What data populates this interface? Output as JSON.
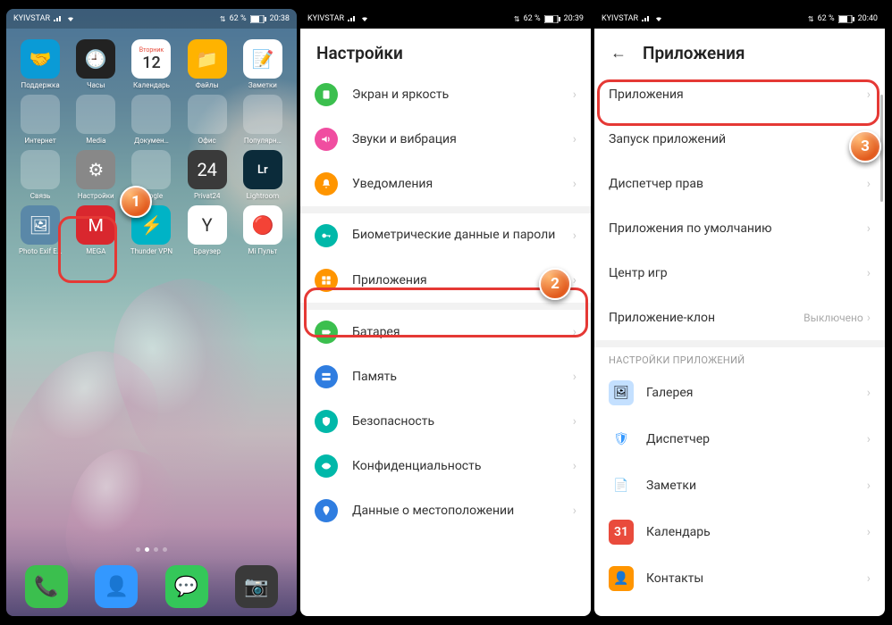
{
  "status": {
    "carrier": "KYIVSTAR",
    "battery": "62 %",
    "times": [
      "20:38",
      "20:39",
      "20:40"
    ]
  },
  "phone1": {
    "apps_row1": [
      {
        "lbl": "Поддержка",
        "bg": "#0a9bd6",
        "glyph": "🤝"
      },
      {
        "lbl": "Часы",
        "bg": "#222",
        "glyph": "🕘"
      },
      {
        "lbl": "Календарь",
        "bg": "#fff",
        "glyph": "cal",
        "day": "Вторник",
        "num": "12"
      },
      {
        "lbl": "Файлы",
        "bg": "#ffb300",
        "glyph": "📁"
      },
      {
        "lbl": "Заметки",
        "bg": "#fff",
        "glyph": "📝"
      }
    ],
    "apps_row2": [
      {
        "lbl": "Интернет",
        "folder": true
      },
      {
        "lbl": "Media",
        "folder": true
      },
      {
        "lbl": "Докумен…",
        "folder": true
      },
      {
        "lbl": "Офис",
        "folder": true
      },
      {
        "lbl": "Популярн…",
        "folder": true
      }
    ],
    "apps_row3": [
      {
        "lbl": "Связь",
        "folder": true
      },
      {
        "lbl": "Настройки",
        "bg": "#888",
        "glyph": "⚙",
        "hl": true
      },
      {
        "lbl": "Google",
        "folder": true
      },
      {
        "lbl": "Privat24",
        "bg": "#3a3a3a",
        "glyph": "24"
      },
      {
        "lbl": "Lightroom",
        "bg": "#0b2b3a",
        "glyph": "Lr"
      }
    ],
    "apps_row4": [
      {
        "lbl": "Photo Exif E…",
        "bg": "#5a88a8",
        "glyph": "🖼"
      },
      {
        "lbl": "MEGA",
        "bg": "#d9272e",
        "glyph": "M"
      },
      {
        "lbl": "Thunder VPN",
        "bg": "#00b3c6",
        "glyph": "⚡"
      },
      {
        "lbl": "Браузер",
        "bg": "#fff",
        "glyph": "Y"
      },
      {
        "lbl": "Mi Пульт",
        "bg": "#fff",
        "glyph": "🔴"
      }
    ],
    "dock": [
      {
        "bg": "#3bbf4e",
        "glyph": "📞",
        "name": "phone-app"
      },
      {
        "bg": "#3398ff",
        "glyph": "👤",
        "name": "contacts-app"
      },
      {
        "bg": "#34c759",
        "glyph": "💬",
        "name": "messages-app"
      },
      {
        "bg": "#3a3a3a",
        "glyph": "📷",
        "name": "camera-app"
      }
    ]
  },
  "phone2": {
    "title": "Настройки",
    "rows": [
      {
        "icon": "display",
        "color": "#3bbf4e",
        "label": "Экран и яркость"
      },
      {
        "icon": "sound",
        "color": "#f04da0",
        "label": "Звуки и вибрация"
      },
      {
        "icon": "bell",
        "color": "#ff9500",
        "label": "Уведомления"
      },
      {
        "icon": "key",
        "color": "#00b8a9",
        "label": "Биометрические данные и пароли",
        "bi": true
      },
      {
        "icon": "apps",
        "color": "#ff9500",
        "label": "Приложения",
        "hl": true
      },
      {
        "icon": "battery",
        "color": "#3bbf4e",
        "label": "Батарея"
      },
      {
        "icon": "storage",
        "color": "#2f7de0",
        "label": "Память"
      },
      {
        "icon": "shield",
        "color": "#00b8a9",
        "label": "Безопасность"
      },
      {
        "icon": "eye",
        "color": "#00b8a9",
        "label": "Конфиденциальность"
      },
      {
        "icon": "location",
        "color": "#2f7de0",
        "label": "Данные о местоположении"
      }
    ]
  },
  "phone3": {
    "title": "Приложения",
    "rows": [
      {
        "label": "Приложения",
        "hl": true
      },
      {
        "label": "Запуск приложений"
      },
      {
        "label": "Диспетчер прав"
      },
      {
        "label": "Приложения по умолчанию"
      },
      {
        "label": "Центр игр"
      },
      {
        "label": "Приложение-клон",
        "value": "Выключено"
      }
    ],
    "section": "НАСТРОЙКИ ПРИЛОЖЕНИЙ",
    "apps": [
      {
        "label": "Галерея",
        "bg": "#c4e0ff",
        "glyph": "🖼"
      },
      {
        "label": "Диспетчер",
        "bg": "#fff",
        "glyph": "🛡"
      },
      {
        "label": "Заметки",
        "bg": "#fff",
        "glyph": "📄"
      },
      {
        "label": "Календарь",
        "bg": "#e94b3c",
        "glyph": "31"
      },
      {
        "label": "Контакты",
        "bg": "#ff9500",
        "glyph": "👤"
      }
    ]
  },
  "steps": {
    "1": "1",
    "2": "2",
    "3": "3"
  }
}
